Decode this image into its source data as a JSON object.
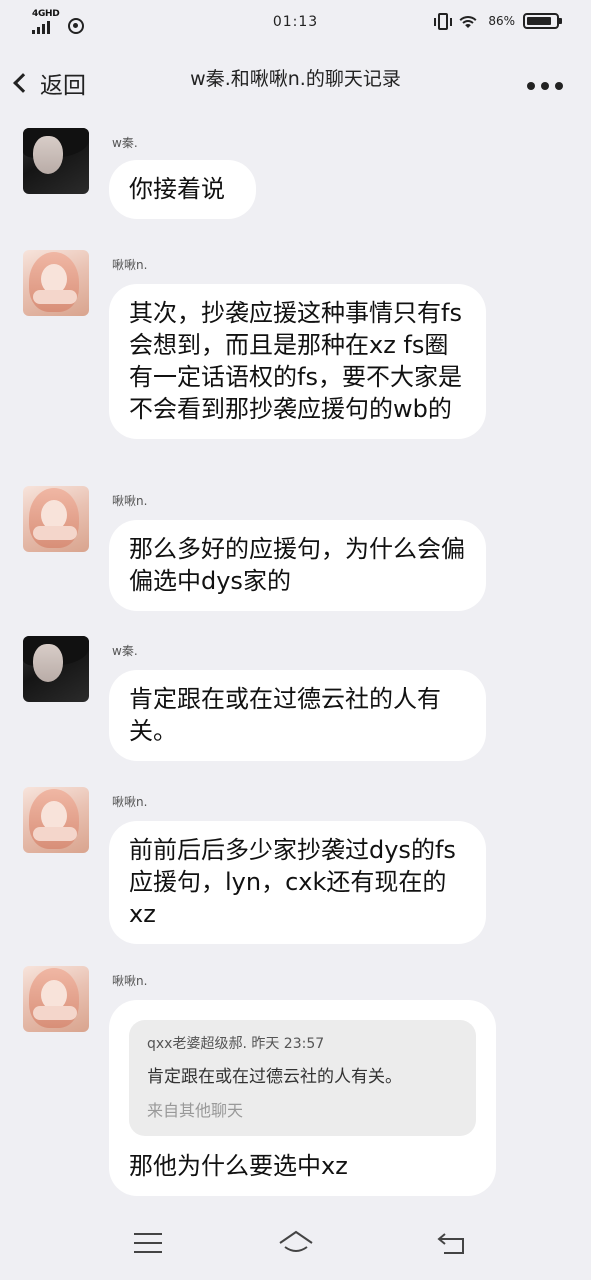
{
  "status_bar": {
    "network": "4GHD",
    "time": "01:13",
    "battery_percent": "86%",
    "battery_level": 0.86,
    "icons": [
      "signal-icon",
      "hotspot-icon",
      "vibrate-icon",
      "wifi-icon",
      "battery-icon"
    ]
  },
  "header": {
    "back_label": "返回",
    "title": "w秦.和啾啾n.的聊天记录",
    "more_icon": "more-dots-icon"
  },
  "messages": [
    {
      "sender": "w秦.",
      "avatar": "dark-hair-avatar",
      "text": "你接着说"
    },
    {
      "sender": "啾啾n.",
      "avatar": "pink-hair-avatar",
      "text": "其次，抄袭应援这种事情只有fs会想到，而且是那种在xz fs圈有一定话语权的fs，要不大家是不会看到那抄袭应援句的wb的"
    },
    {
      "sender": "啾啾n.",
      "avatar": "pink-hair-avatar",
      "text": "那么多好的应援句，为什么会偏偏选中dys家的"
    },
    {
      "sender": "w秦.",
      "avatar": "dark-hair-avatar",
      "text": "肯定跟在或在过德云社的人有关。"
    },
    {
      "sender": "啾啾n.",
      "avatar": "pink-hair-avatar",
      "text": "前前后后多少家抄袭过dys的fs应援句，lyn，cxk还有现在的xz"
    },
    {
      "sender": "啾啾n.",
      "avatar": "pink-hair-avatar",
      "quote": {
        "header": "qxx老婆超级郝. 昨天 23:57",
        "text": "肯定跟在或在过德云社的人有关。",
        "source": "来自其他聊天"
      },
      "text": "那他为什么要选中xz"
    }
  ],
  "nav_bar": {
    "icons": [
      "menu-icon",
      "home-icon",
      "back-icon"
    ]
  }
}
